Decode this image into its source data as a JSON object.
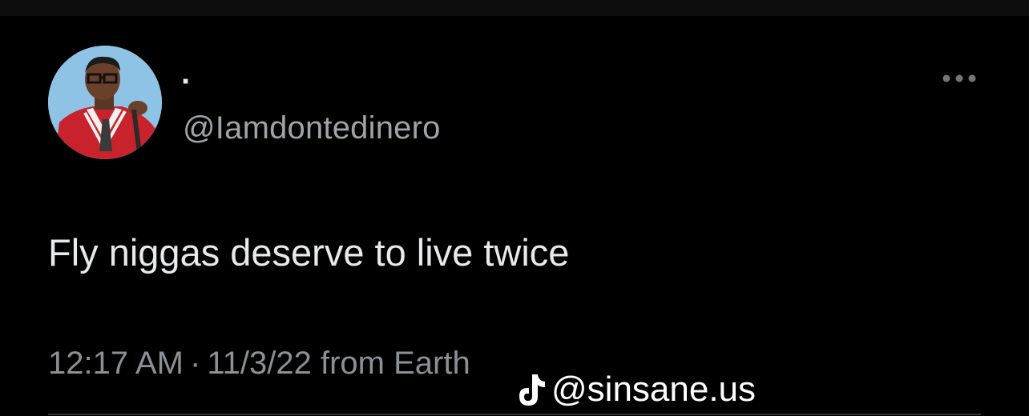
{
  "tweet": {
    "display_name": "·",
    "handle": "@Iamdontedinero",
    "text": "Fly niggas deserve to live twice",
    "time": "12:17 AM",
    "separator": "·",
    "date": "11/3/22",
    "source": "from Earth"
  },
  "watermark": {
    "text": "@sinsane.us",
    "icon": "tiktok-icon"
  },
  "icons": {
    "more": "more-horizontal-icon"
  },
  "colors": {
    "background": "#000000",
    "primary_text": "#e7e9ea",
    "secondary_text": "#8b9096",
    "divider": "#2f3336"
  }
}
